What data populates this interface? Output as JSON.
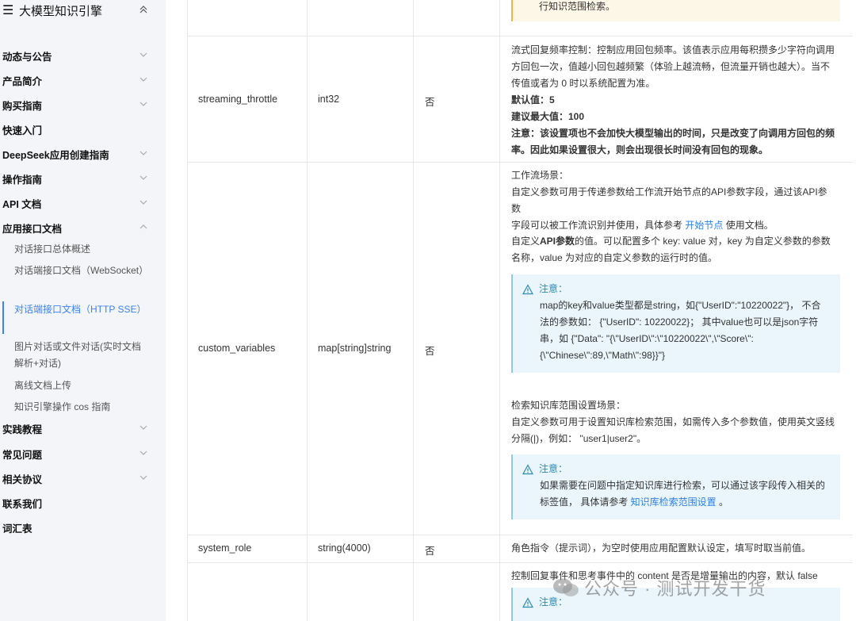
{
  "sidebar": {
    "title": "大模型知识引擎",
    "collapse_icon": "chevron-up-double",
    "items": [
      {
        "label": "动态与公告",
        "has_chevron": true
      },
      {
        "label": "产品简介",
        "has_chevron": true
      },
      {
        "label": "购买指南",
        "has_chevron": true
      },
      {
        "label": "快速入门",
        "has_chevron": false
      },
      {
        "label": "DeepSeek应用创建指南",
        "has_chevron": true
      },
      {
        "label": "操作指南",
        "has_chevron": true
      },
      {
        "label": "API 文档",
        "has_chevron": true
      },
      {
        "label": "应用接口文档",
        "has_chevron": true,
        "expanded": true
      },
      {
        "label": "实践教程",
        "has_chevron": true
      },
      {
        "label": "常见问题",
        "has_chevron": true
      },
      {
        "label": "相关协议",
        "has_chevron": true
      },
      {
        "label": "联系我们",
        "has_chevron": false
      },
      {
        "label": "词汇表",
        "has_chevron": false
      }
    ],
    "subitems": [
      {
        "label": "对话接口总体概述"
      },
      {
        "label": "对话端接口文档（WebSocket）"
      },
      {
        "label": "对话端接口文档（HTTP SSE）",
        "active": true
      },
      {
        "label": "图片对话或文件对话(实时文档解析+对话)"
      },
      {
        "label": "离线文档上传"
      },
      {
        "label": "知识引擎操作 cos 指南"
      }
    ]
  },
  "table": {
    "top_warning": "行知识范围检索。",
    "rows": [
      {
        "name": "streaming_throttle",
        "type": "int32",
        "required": "否",
        "desc_lines": [
          "流式回复频率控制：控制应用回包频率。该值表示应用每积攒多少字符向调用",
          "方回包一次，值越小回包越频繁（体验上越流畅，但流量开销也越大）。当不",
          "传值或者为 0 时以系统配置为准。"
        ],
        "default_label": "默认值：5",
        "max_label": "建议最大值：100",
        "note_lines": [
          "注意：该设置项也不会加快大模型输出的时间，只是改变了向调用方回包的频",
          "率。因此如果设置很大，则会出现很长时间没有回包的现象。"
        ]
      },
      {
        "name": "custom_variables",
        "type": "map[string]string",
        "required": "否",
        "workflow_title": "工作流场景：",
        "workflow_line1": "自定义参数可用于传递参数给工作流开始节点的API参数字段，通过该API参数",
        "workflow_line2_pre": "字段可以被工作流识别并使用，具体参考 ",
        "workflow_link": "开始节点",
        "workflow_line2_post": " 使用文档。",
        "api_line1_pre": "自定义",
        "api_line1_bold": "API参数",
        "api_line1_post": "的值。可以配置多个 key: value 对，key 为自定义参数的参数",
        "api_line2": "名称，value 为对应的自定义参数的运行时的值。",
        "note1_head": "注意：",
        "note1_lines": [
          "map的key和value类型都是string，如{\"UserID\":\"10220022\"}，  不合",
          "法的参数如：  {\"UserID\": 10220022}；  其中value也可以是json字符",
          "串，如 {\"Data\": \"{\\\"UserID\\\":\\\"10220022\\\",\\\"Score\\\":",
          "{\\\"Chinese\\\":89,\\\"Math\\\":98}}\"}"
        ],
        "kb_title": "检索知识库范围设置场景：",
        "kb_line1": "自定义参数可用于设置知识库检索范围，如需传入多个参数值，使用英文竖线",
        "kb_line2": "分隔(|)，例如：  \"user1|user2\"。",
        "note2_head": "注意：",
        "note2_line1": "如果需要在问题中指定知识库进行检索，可以通过该字段传入相关的",
        "note2_line2_pre": "标签值，  具体请参考 ",
        "note2_link": "知识库检索范围设置",
        "note2_line2_post": " 。"
      },
      {
        "name": "system_role",
        "type": "string(4000)",
        "required": "否",
        "desc": "角色指令（提示词），为空时使用应用配置默认设定，填写时取当前值。"
      },
      {
        "desc_partial": "控制回复事件和思考事件中的 content 是否是增量输出的内容，默认 false",
        "note_head": "注意："
      }
    ]
  },
  "watermark": "公众号 · 测试开发干货",
  "colors": {
    "accent": "#3b82f6",
    "link": "#2d7fe8",
    "note_bg": "#eaf6fb",
    "warn_bg": "#fdf7e7"
  }
}
